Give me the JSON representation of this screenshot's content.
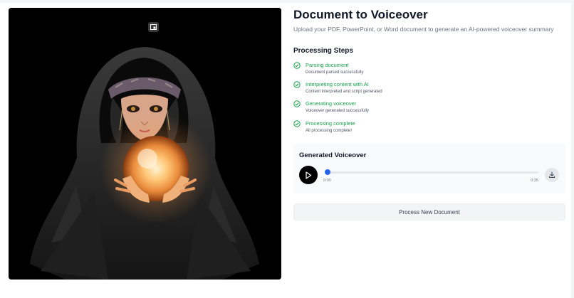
{
  "header": {
    "title": "Document to Voiceover",
    "subtitle": "Upload your PDF, PowerPoint, or Word document to generate an AI-powered voiceover summary"
  },
  "image": {
    "icon": "picture-in-picture-icon"
  },
  "steps": {
    "heading": "Processing Steps",
    "items": [
      {
        "label": "Parsing document",
        "detail": "Document parsed successfully",
        "status": "complete",
        "icon": "check-circle-icon"
      },
      {
        "label": "Interpreting content with AI",
        "detail": "Content interpreted and script generated",
        "status": "complete",
        "icon": "check-circle-icon"
      },
      {
        "label": "Generating voiceover",
        "detail": "Voiceover generated successfully",
        "status": "complete",
        "icon": "check-circle-icon"
      },
      {
        "label": "Processing complete",
        "detail": "All processing complete!",
        "status": "complete",
        "icon": "check-circle-icon"
      }
    ]
  },
  "player": {
    "title": "Generated Voiceover",
    "current_time": "0:00",
    "total_time": "0:35",
    "progress": 0,
    "play_icon": "play-icon",
    "download_icon": "download-icon"
  },
  "actions": {
    "process_new_label": "Process New Document"
  },
  "colors": {
    "success": "#16a34a",
    "accent": "#2563eb",
    "image_background": "#000000"
  }
}
